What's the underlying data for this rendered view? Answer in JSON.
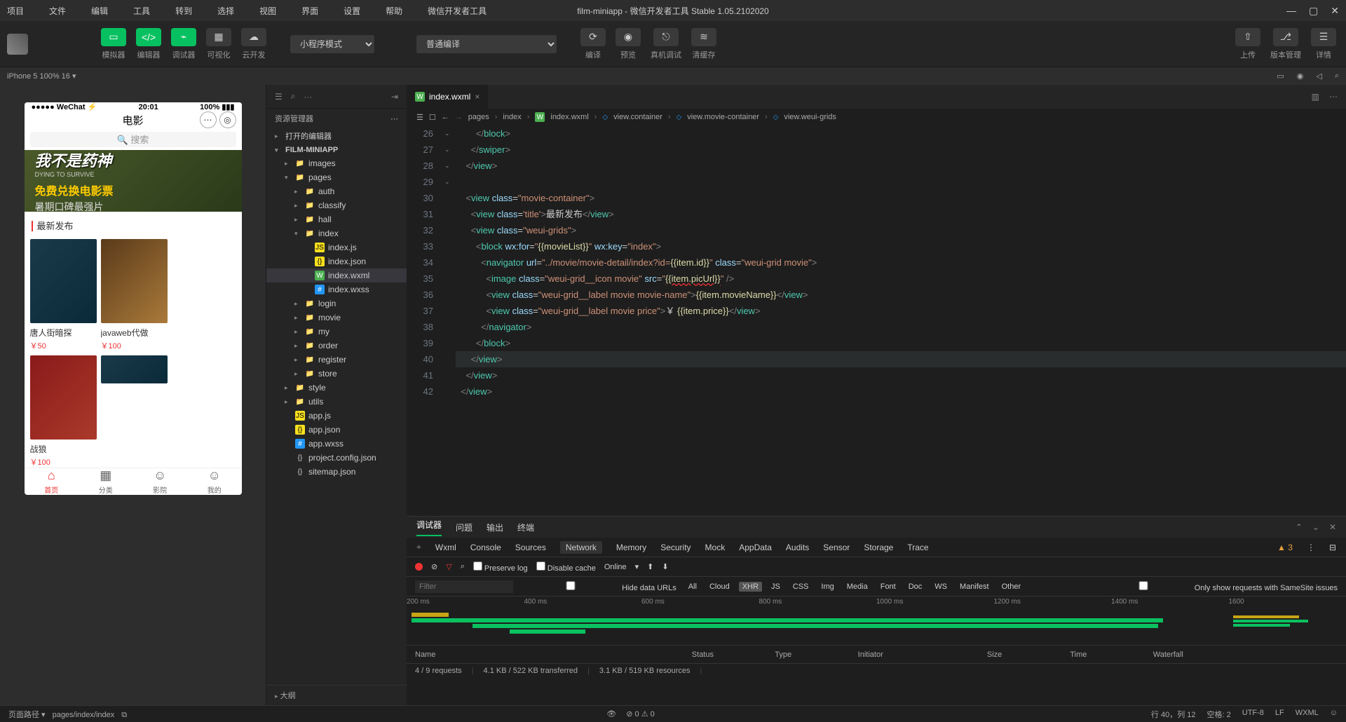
{
  "menu": [
    "项目",
    "文件",
    "编辑",
    "工具",
    "转到",
    "选择",
    "视图",
    "界面",
    "设置",
    "帮助",
    "微信开发者工具"
  ],
  "windowTitle": "film-miniapp - 微信开发者工具 Stable 1.05.2102020",
  "toolbar": {
    "items": [
      {
        "icon": "▭",
        "label": "模拟器",
        "green": true
      },
      {
        "icon": "</>",
        "label": "编辑器",
        "green": true
      },
      {
        "icon": "⌁",
        "label": "调试器",
        "green": true
      },
      {
        "icon": "▦",
        "label": "可视化",
        "green": false
      },
      {
        "icon": "☁",
        "label": "云开发",
        "green": false
      }
    ],
    "modeSelect": "小程序模式",
    "compileSelect": "普通编译",
    "actions": [
      {
        "icon": "⟳",
        "label": "编译"
      },
      {
        "icon": "◉",
        "label": "预览"
      },
      {
        "icon": "⎋",
        "label": "真机调试"
      },
      {
        "icon": "≋",
        "label": "清缓存"
      }
    ],
    "right": [
      {
        "icon": "⇧",
        "label": "上传"
      },
      {
        "icon": "⎇",
        "label": "版本管理"
      },
      {
        "icon": "☰",
        "label": "详情"
      }
    ]
  },
  "deviceBar": {
    "device": "iPhone 5 100% 16 ▾",
    "icons": [
      "▭",
      "◉",
      "◁",
      "⌕"
    ]
  },
  "explorer": {
    "sidebarIcons": [
      "☰",
      "⌕",
      "···"
    ],
    "title": "资源管理器",
    "sections": [
      "打开的编辑器",
      "FILM-MINIAPP"
    ],
    "tree": [
      {
        "depth": 1,
        "arrow": "▸",
        "icon": "folder",
        "name": "images"
      },
      {
        "depth": 1,
        "arrow": "▾",
        "icon": "folder",
        "name": "pages"
      },
      {
        "depth": 2,
        "arrow": "▸",
        "icon": "folder",
        "name": "auth"
      },
      {
        "depth": 2,
        "arrow": "▸",
        "icon": "folder",
        "name": "classify"
      },
      {
        "depth": 2,
        "arrow": "▸",
        "icon": "folder",
        "name": "hall"
      },
      {
        "depth": 2,
        "arrow": "▾",
        "icon": "folder",
        "name": "index"
      },
      {
        "depth": 3,
        "arrow": "",
        "icon": "js",
        "name": "index.js"
      },
      {
        "depth": 3,
        "arrow": "",
        "icon": "json",
        "name": "index.json"
      },
      {
        "depth": 3,
        "arrow": "",
        "icon": "wxml",
        "name": "index.wxml",
        "active": true
      },
      {
        "depth": 3,
        "arrow": "",
        "icon": "wxss",
        "name": "index.wxss"
      },
      {
        "depth": 2,
        "arrow": "▸",
        "icon": "folder",
        "name": "login"
      },
      {
        "depth": 2,
        "arrow": "▸",
        "icon": "folder",
        "name": "movie"
      },
      {
        "depth": 2,
        "arrow": "▸",
        "icon": "folder",
        "name": "my"
      },
      {
        "depth": 2,
        "arrow": "▸",
        "icon": "folder",
        "name": "order"
      },
      {
        "depth": 2,
        "arrow": "▸",
        "icon": "folder",
        "name": "register"
      },
      {
        "depth": 2,
        "arrow": "▸",
        "icon": "folder",
        "name": "store"
      },
      {
        "depth": 1,
        "arrow": "▸",
        "icon": "folder",
        "name": "style"
      },
      {
        "depth": 1,
        "arrow": "▸",
        "icon": "folder",
        "name": "utils"
      },
      {
        "depth": 1,
        "arrow": "",
        "icon": "js",
        "name": "app.js"
      },
      {
        "depth": 1,
        "arrow": "",
        "icon": "json",
        "name": "app.json"
      },
      {
        "depth": 1,
        "arrow": "",
        "icon": "wxss",
        "name": "app.wxss"
      },
      {
        "depth": 1,
        "arrow": "",
        "icon": "config",
        "name": "project.config.json"
      },
      {
        "depth": 1,
        "arrow": "",
        "icon": "config",
        "name": "sitemap.json"
      }
    ],
    "outline": "大纲"
  },
  "simulator": {
    "status": {
      "left": "●●●●● WeChat ⚡",
      "center": "20:01",
      "right": "100% ▮▮▮"
    },
    "navTitle": "电影",
    "searchPlaceholder": "🔍 搜索",
    "banner": {
      "l1": "我不是药神",
      "l1en": "DYING TO SURVIVE",
      "l2": "免费兑换电影票",
      "l3": "暑期口碑最强片"
    },
    "sectionTitle": "最新发布",
    "movies": [
      {
        "name": "唐人街暗探",
        "price": "￥50"
      },
      {
        "name": "javaweb代做",
        "price": "￥100"
      },
      {
        "name": "战狼",
        "price": "￥100"
      }
    ],
    "tabs": [
      {
        "icon": "⌂",
        "label": "首页",
        "active": true
      },
      {
        "icon": "▦",
        "label": "分类"
      },
      {
        "icon": "☺",
        "label": "影院"
      },
      {
        "icon": "☺",
        "label": "我的"
      }
    ]
  },
  "editor": {
    "tabFile": "index.wxml",
    "breadcrumb": [
      "pages",
      "index",
      "index.wxml",
      "view.container",
      "view.movie-container",
      "view.weui-grids"
    ],
    "lineStart": 26,
    "lines": [
      {
        "n": 26,
        "html": "        <span class='punct'>&lt;/</span><span class='tag'>block</span><span class='punct'>&gt;</span>"
      },
      {
        "n": 27,
        "html": "      <span class='punct'>&lt;/</span><span class='tag'>swiper</span><span class='punct'>&gt;</span>"
      },
      {
        "n": 28,
        "html": "    <span class='punct'>&lt;/</span><span class='tag'>view</span><span class='punct'>&gt;</span>"
      },
      {
        "n": 29,
        "html": ""
      },
      {
        "n": 30,
        "fold": "⌄",
        "html": "    <span class='punct'>&lt;</span><span class='tag'>view</span> <span class='attr'>class</span>=<span class='str'>\"movie-container\"</span><span class='punct'>&gt;</span>"
      },
      {
        "n": 31,
        "html": "      <span class='punct'>&lt;</span><span class='tag'>view</span> <span class='attr'>class</span>=<span class='str'>'title'</span><span class='punct'>&gt;</span>最新发布<span class='punct'>&lt;/</span><span class='tag'>view</span><span class='punct'>&gt;</span>"
      },
      {
        "n": 32,
        "fold": "⌄",
        "html": "      <span class='punct'>&lt;</span><span class='tag'>view</span> <span class='attr'>class</span>=<span class='str'>\"weui-grids\"</span><span class='punct'>&gt;</span>"
      },
      {
        "n": 33,
        "fold": "⌄",
        "html": "        <span class='punct'>&lt;</span><span class='tag'>block</span> <span class='attr'>wx:for</span>=<span class='str'>\"</span><span class='exp'>{{movieList}}</span><span class='str'>\"</span> <span class='attr'>wx:key</span>=<span class='str'>\"index\"</span><span class='punct'>&gt;</span>"
      },
      {
        "n": 34,
        "fold": "⌄",
        "html": "          <span class='punct'>&lt;</span><span class='tag'>navigator</span> <span class='attr'>url</span>=<span class='str'>\"../movie/movie-detail/index?id=</span><span class='exp'>{{item.id}}</span><span class='str'>\"</span> <span class='attr'>class</span>=<span class='str'>\"weui-grid movie\"</span><span class='punct'>&gt;</span>"
      },
      {
        "n": 35,
        "html": "            <span class='punct'>&lt;</span><span class='tag'>image</span> <span class='attr'>class</span>=<span class='str'>\"weui-grid__icon movie\"</span> <span class='attr'>src</span>=<span class='str'>\"</span><span class='exp' style='text-decoration:underline wavy #e33'>{{item.picUrl}}</span><span class='str'>\"</span> <span class='punct'>/&gt;</span>"
      },
      {
        "n": 36,
        "html": "            <span class='punct'>&lt;</span><span class='tag'>view</span> <span class='attr'>class</span>=<span class='str'>\"weui-grid__label movie movie-name\"</span><span class='punct'>&gt;</span><span class='exp'>{{item.movieName}}</span><span class='punct'>&lt;/</span><span class='tag'>view</span><span class='punct'>&gt;</span>"
      },
      {
        "n": 37,
        "html": "            <span class='punct'>&lt;</span><span class='tag'>view</span> <span class='attr'>class</span>=<span class='str'>\"weui-grid__label movie price\"</span><span class='punct'>&gt;</span>￥ <span class='exp'>{{item.price}}</span><span class='punct'>&lt;/</span><span class='tag'>view</span><span class='punct'>&gt;</span>"
      },
      {
        "n": 38,
        "html": "          <span class='punct'>&lt;/</span><span class='tag'>navigator</span><span class='punct'>&gt;</span>"
      },
      {
        "n": 39,
        "html": "        <span class='punct'>&lt;/</span><span class='tag'>block</span><span class='punct'>&gt;</span>"
      },
      {
        "n": 40,
        "hl": true,
        "html": "      <span class='punct'>&lt;/</span><span class='tag'>view</span><span class='punct'>&gt;</span>"
      },
      {
        "n": 41,
        "html": "    <span class='punct'>&lt;/</span><span class='tag'>view</span><span class='punct'>&gt;</span>"
      },
      {
        "n": 42,
        "html": "  <span class='punct'>&lt;/</span><span class='tag'>view</span><span class='punct'>&gt;</span>"
      }
    ]
  },
  "devtools": {
    "topTabs": [
      "调试器",
      "问题",
      "输出",
      "终端"
    ],
    "subTabs": [
      "Wxml",
      "Console",
      "Sources",
      "Network",
      "Memory",
      "Security",
      "Mock",
      "AppData",
      "Audits",
      "Sensor",
      "Storage",
      "Trace"
    ],
    "subActive": "Network",
    "warnCount": "3",
    "row2": {
      "preserve": "Preserve log",
      "disable": "Disable cache",
      "online": "Online"
    },
    "filterPlaceholder": "Filter",
    "hideData": "Hide data URLs",
    "pills": [
      "All",
      "Cloud",
      "XHR",
      "JS",
      "CSS",
      "Img",
      "Media",
      "Font",
      "Doc",
      "WS",
      "Manifest",
      "Other"
    ],
    "pillActive": "XHR",
    "samesite": "Only show requests with SameSite issues",
    "timeLabels": [
      "200 ms",
      "400 ms",
      "600 ms",
      "800 ms",
      "1000 ms",
      "1200 ms",
      "1400 ms",
      "1600"
    ],
    "netHeaders": [
      "Name",
      "Status",
      "Type",
      "Initiator",
      "Size",
      "Time",
      "Waterfall"
    ],
    "netFooter": [
      "4 / 9 requests",
      "4.1 KB / 522 KB transferred",
      "3.1 KB / 519 KB resources"
    ]
  },
  "statusbar": {
    "left": [
      "页面路径 ▾",
      "pages/index/index",
      "⧉"
    ],
    "mid": [
      "👁",
      "⊘ 0 ⚠ 0"
    ],
    "right": [
      "行 40，列 12",
      "空格: 2",
      "UTF-8",
      "LF",
      "WXML",
      "☺"
    ]
  }
}
